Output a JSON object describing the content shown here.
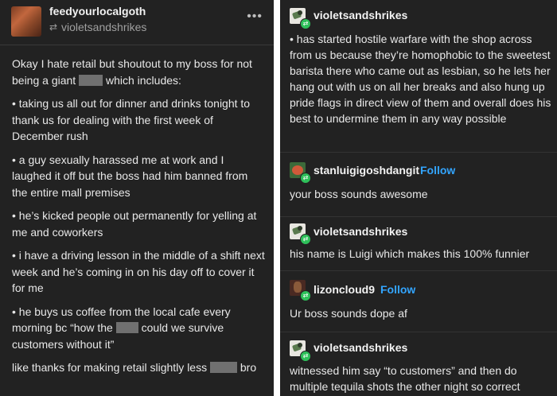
{
  "left_post": {
    "username": "feedyourlocalgoth",
    "reblogged_from": "violetsandshrikes",
    "menu_glyph": "•••",
    "intro_before": "Okay I hate retail but shoutout to my boss for not being a giant",
    "intro_after": "which includes:",
    "bullet_1": "• taking us all out for dinner and drinks tonight to thank us for dealing with the first week of December rush",
    "bullet_2": "• a guy sexually harassed me at work and I laughed it off but the boss had him banned from the entire mall premises",
    "bullet_3": "• he’s kicked people out permanently for yelling at me and coworkers",
    "bullet_4": "• i have a driving lesson in the middle of a shift next week and he’s coming in on his day off to cover it for me",
    "bullet_5_before": "• he buys us coffee from the local cafe every morning bc “how the",
    "bullet_5_after": "could we survive customers without it”",
    "closing_before": "like thanks for making retail slightly less",
    "closing_after": "bro"
  },
  "right_thread": {
    "entry_1": {
      "username": "violetsandshrikes",
      "text": "• has started hostile warfare with the shop across from us because they’re homophobic to the sweetest barista there who came out as lesbian, so he lets her hang out with us on all her breaks and also hung up pride flags in direct view of them and overall does his best to undermine them in any way possible"
    },
    "entry_2": {
      "username": "stanluigigoshdangit",
      "follow_label": "Follow",
      "text": "your boss sounds awesome"
    },
    "entry_3": {
      "username": "violetsandshrikes",
      "text": "his name is Luigi which makes this 100% funnier"
    },
    "entry_4": {
      "username": "lizoncloud9",
      "follow_label": "Follow",
      "text": "Ur boss sounds dope af"
    },
    "entry_5": {
      "username": "violetsandshrikes",
      "text": "witnessed him say “to customers” and then do multiple tequila shots the other night so correct"
    }
  },
  "colors": {
    "panel_bg": "#222222",
    "text": "#e8e8e8",
    "follow_blue": "#33a5ff",
    "reblog_green": "#2ec05a",
    "redaction_gray": "#707070"
  },
  "icons": {
    "reblog": "reblog-icon",
    "menu": "more-options-icon"
  }
}
